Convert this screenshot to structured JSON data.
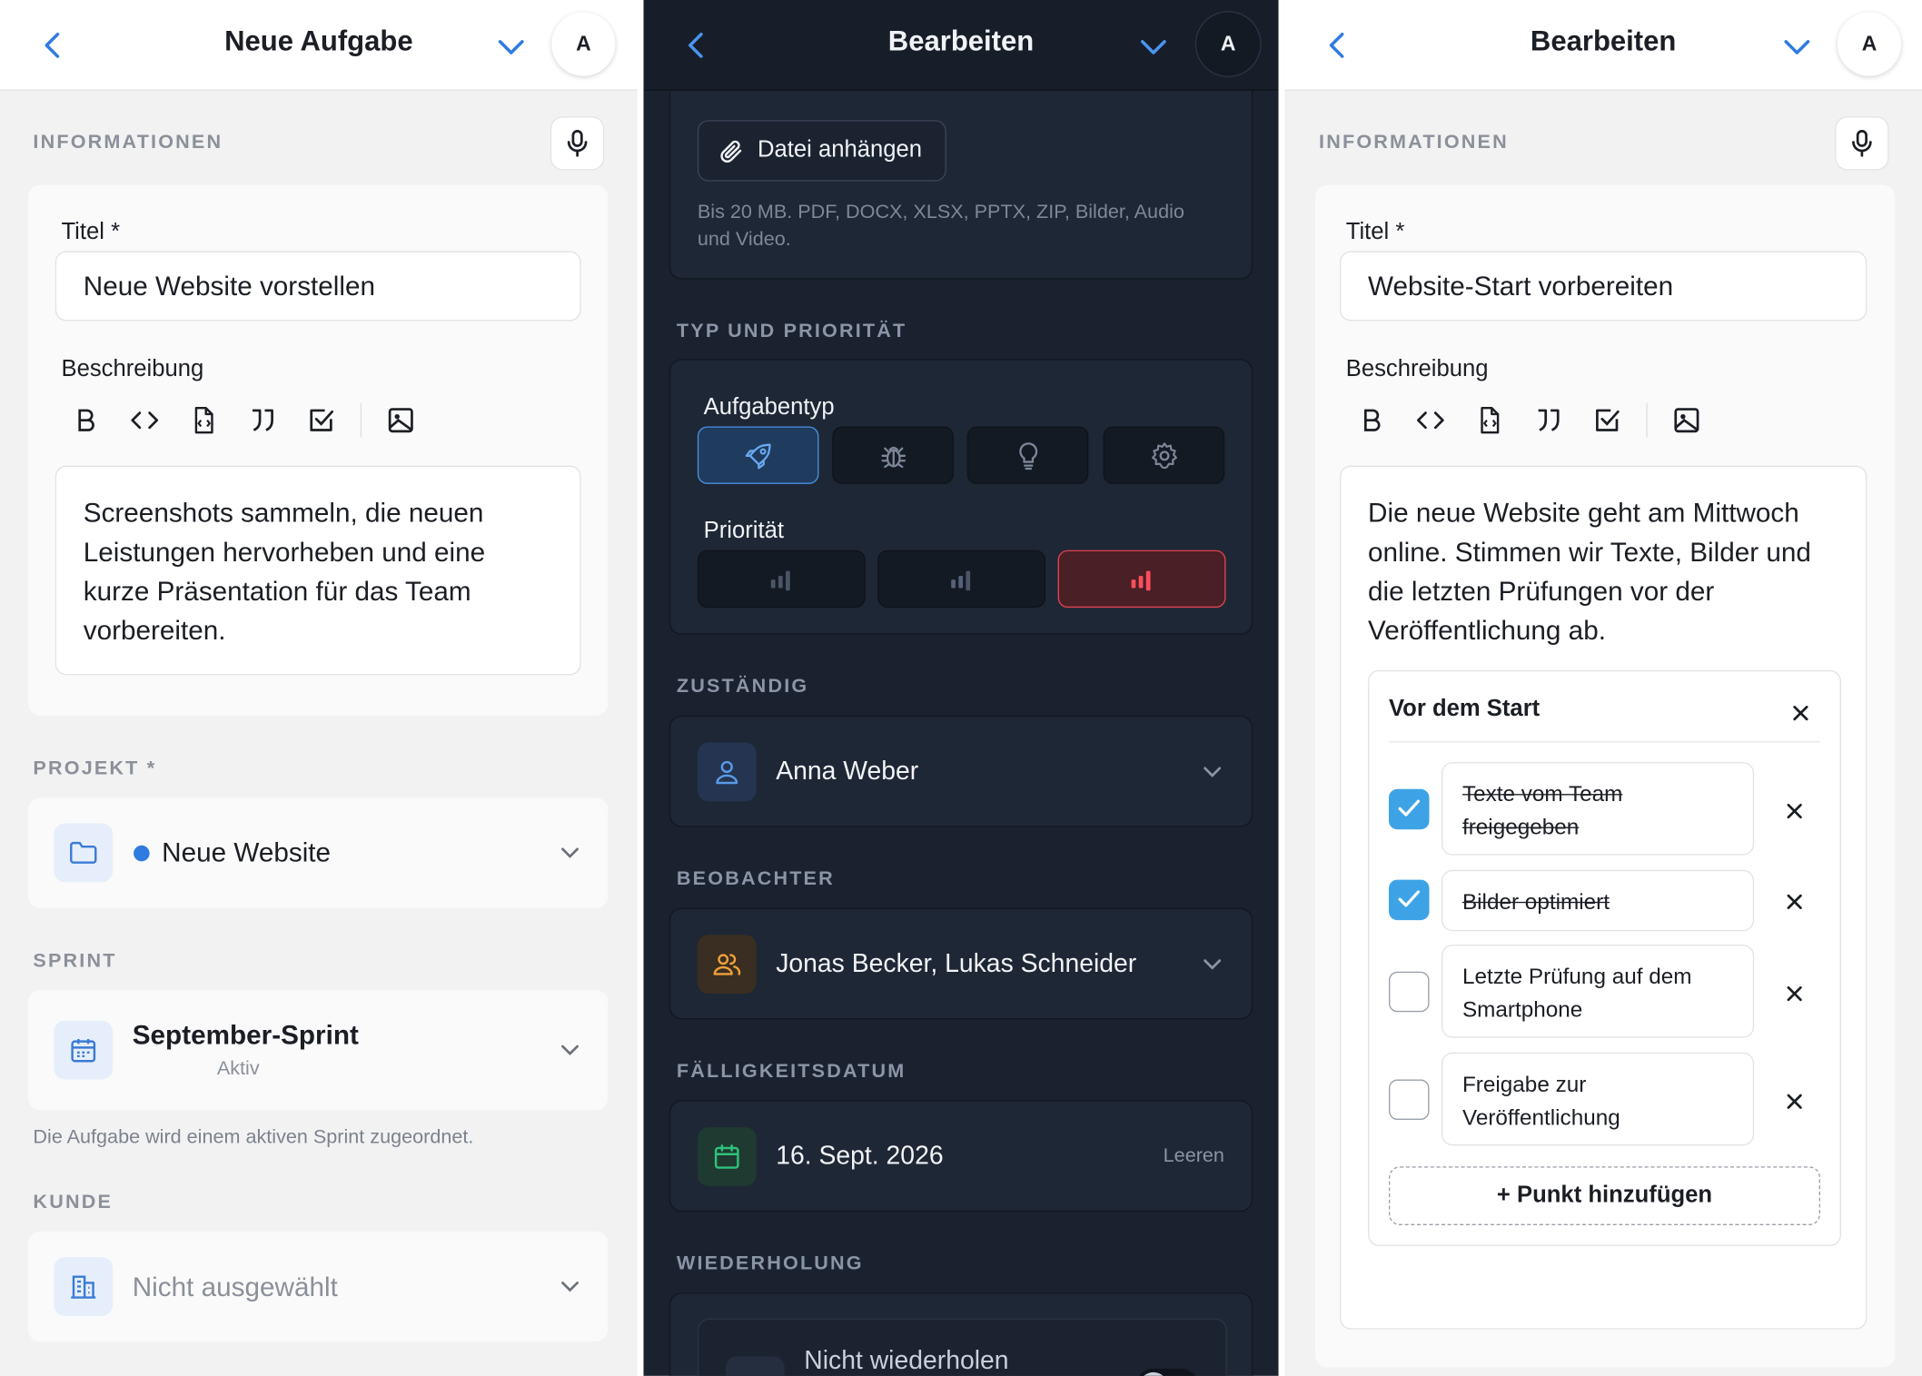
{
  "panel1": {
    "title": "Neue Aufgabe",
    "avatar": "A",
    "section_info": "INFORMATIONEN",
    "title_label": "Titel *",
    "title_value": "Neue Website vorstellen",
    "desc_label": "Beschreibung",
    "desc_value": "Screenshots sammeln, die neuen Leistungen hervorheben und eine kurze Präsentation für das Team vorbereiten.",
    "section_project": "PROJEKT *",
    "project_value": "Neue Website",
    "section_sprint": "SPRINT",
    "sprint_value": "September-Sprint",
    "sprint_status": "Aktiv",
    "sprint_hint": "Die Aufgabe wird einem aktiven Sprint zugeordnet.",
    "section_customer": "KUNDE",
    "customer_value": "Nicht ausgewählt"
  },
  "panel2": {
    "title": "Bearbeiten",
    "avatar": "A",
    "attach_label": "Datei anhängen",
    "attach_hint": "Bis 20 MB. PDF, DOCX, XLSX, PPTX, ZIP, Bilder, Audio und Video.",
    "section_type": "TYP UND PRIORITÄT",
    "type_label": "Aufgabentyp",
    "priority_label": "Priorität",
    "section_assignee": "ZUSTÄNDIG",
    "assignee_value": "Anna Weber",
    "section_watchers": "BEOBACHTER",
    "watchers_value": "Jonas Becker, Lukas Schneider",
    "section_due": "FÄLLIGKEITSDATUM",
    "due_value": "16. Sept. 2026",
    "due_clear": "Leeren",
    "section_repeat": "WIEDERHOLUNG",
    "repeat_value": "Nicht wiederholen"
  },
  "panel3": {
    "title": "Bearbeiten",
    "avatar": "A",
    "section_info": "INFORMATIONEN",
    "title_label": "Titel *",
    "title_value": "Website-Start vorbereiten",
    "desc_label": "Beschreibung",
    "desc_value": "Die neue Website geht am Mittwoch online. Stimmen wir Texte, Bilder und die letzten Prüfungen vor der Veröffentlichung ab.",
    "checklist_title": "Vor dem Start",
    "checklist": [
      {
        "text": "Texte vom Team freigegeben",
        "checked": true
      },
      {
        "text": "Bilder optimiert",
        "checked": true
      },
      {
        "text": "Letzte Prüfung auf dem Smartphone",
        "checked": false
      },
      {
        "text": "Freigabe zur Veröffentlichung",
        "checked": false
      }
    ],
    "add_item": "Punkt hinzufügen"
  },
  "colors": {
    "accent_blue": "#3a7bd5",
    "check_blue": "#3ea3e6",
    "priority_red": "#e0434f",
    "dark_bg": "#1a2230"
  }
}
